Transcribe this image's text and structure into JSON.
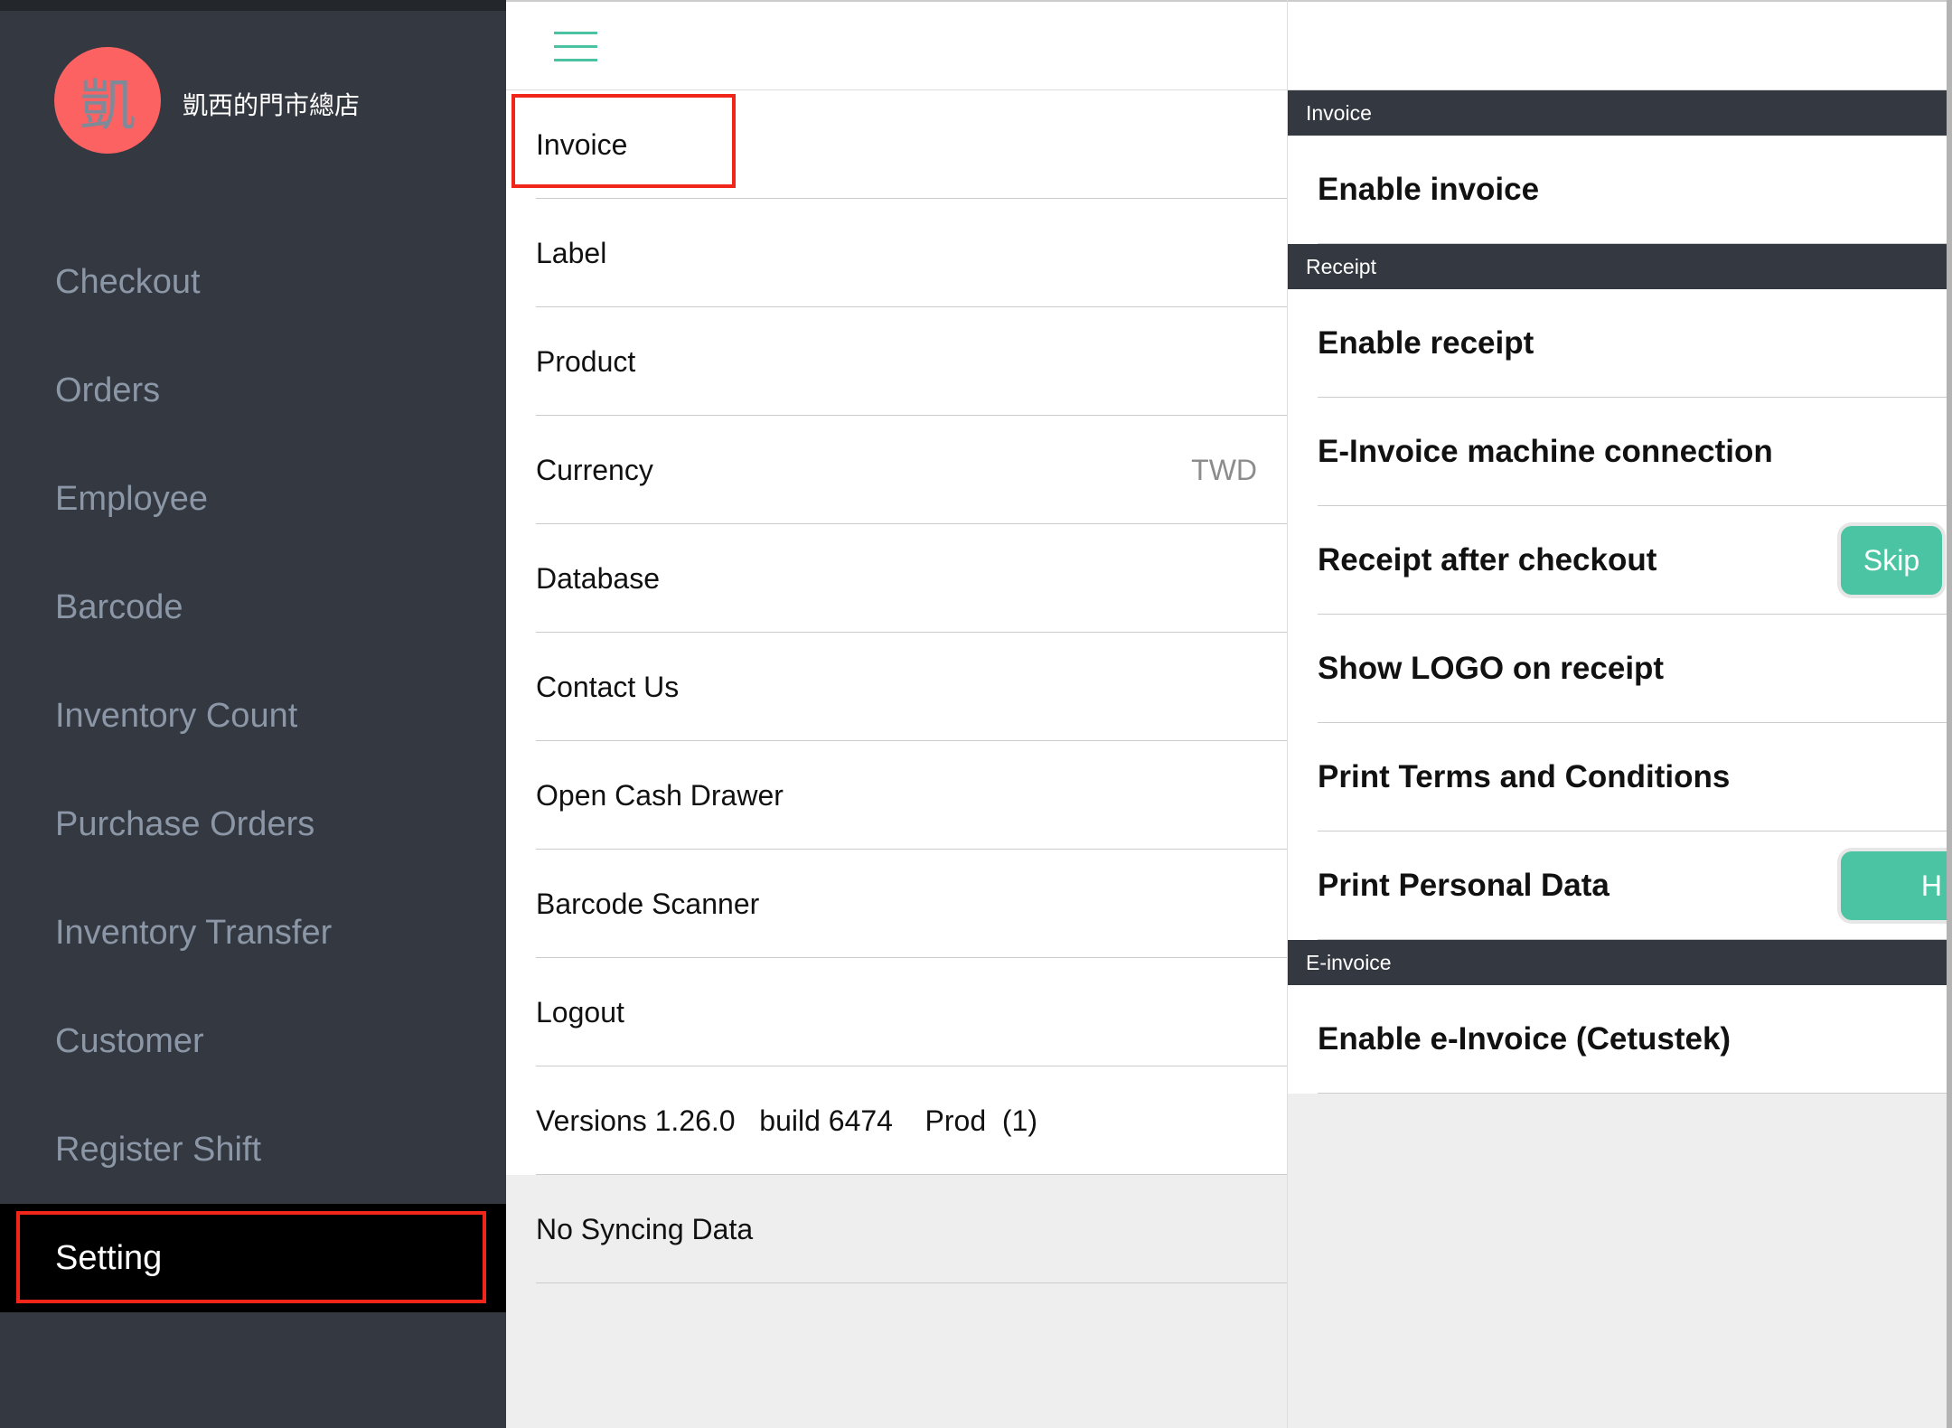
{
  "sidebar": {
    "avatar_char": "凱",
    "store_name": "凱西的門市總店",
    "items": [
      "Checkout",
      "Orders",
      "Employee",
      "Barcode",
      "Inventory Count",
      "Purchase Orders",
      "Inventory Transfer",
      "Customer",
      "Register Shift",
      "Setting"
    ],
    "active": "Setting"
  },
  "middle": {
    "menu_icon": "hamburger-icon",
    "items": [
      {
        "label": "Invoice"
      },
      {
        "label": "Label"
      },
      {
        "label": "Product"
      },
      {
        "label": "Currency",
        "value": "TWD"
      },
      {
        "label": "Database"
      },
      {
        "label": "Contact Us"
      },
      {
        "label": "Open Cash Drawer"
      },
      {
        "label": "Barcode Scanner"
      },
      {
        "label": "Logout"
      },
      {
        "label": "Versions 1.26.0   build 6474    Prod  (1)"
      }
    ],
    "sync_status": "No Syncing Data"
  },
  "right": {
    "sections": [
      {
        "title": "Invoice",
        "rows": [
          {
            "label": "Enable invoice"
          }
        ]
      },
      {
        "title": "Receipt",
        "rows": [
          {
            "label": "Enable receipt"
          },
          {
            "label": "E-Invoice machine connection"
          },
          {
            "label": "Receipt after checkout",
            "button": "Skip"
          },
          {
            "label": "Show LOGO on receipt"
          },
          {
            "label": "Print Terms and Conditions"
          },
          {
            "label": "Print Personal Data",
            "button": "H"
          }
        ]
      },
      {
        "title": "E-invoice",
        "rows": [
          {
            "label": "Enable e-Invoice (Cetustek)"
          }
        ]
      }
    ]
  },
  "colors": {
    "accent": "#4bc4a3",
    "sidebar": "#343840",
    "highlight": "#f0261a",
    "avatar": "#fd6262"
  }
}
